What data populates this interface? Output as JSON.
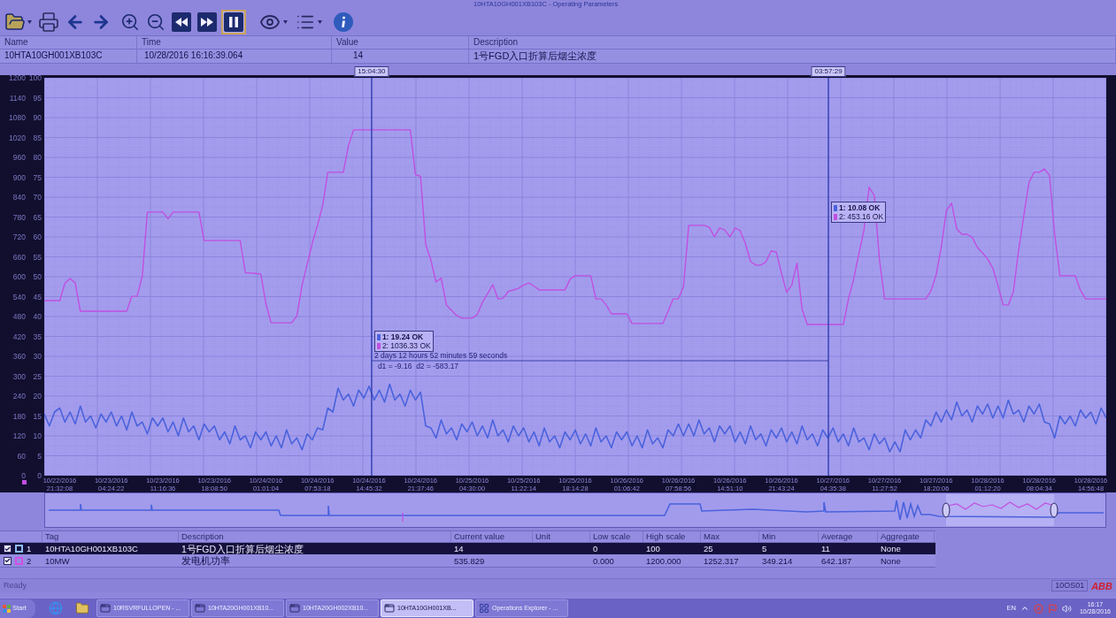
{
  "window": {
    "title": "10HTA10GH001XB103C - Operating Parameters"
  },
  "toolbar": {
    "pause_active": true
  },
  "header_table": {
    "columns": [
      "Name",
      "Time",
      "Value",
      "Description"
    ],
    "row": [
      "10HTA10GH001XB103C",
      "10/28/2016 16:16:39.064",
      "14",
      "1号FGD入口折算后烟尘浓度"
    ]
  },
  "cursors": [
    {
      "label": "15:04:30",
      "readings": [
        "1: 19.24 OK",
        "2: 1036.33 OK"
      ]
    },
    {
      "label": "03:57:29",
      "readings": [
        "1: 10.08 OK",
        "2: 453.16 OK"
      ]
    }
  ],
  "cursor_span": {
    "duration": "2 days 12 hours 52 minutes 59 seconds",
    "difference": "d1 = -9.16  d2 = -583.17"
  },
  "chart_data": {
    "type": "line",
    "grid": true,
    "categories": [
      null,
      null,
      null,
      "10/22/2016 21:32:08",
      null,
      null,
      null,
      null,
      null,
      null,
      null,
      null,
      null,
      "10/23/2016 04:24:22",
      null,
      null,
      null,
      null,
      null,
      null,
      null,
      null,
      null,
      "10/23/2016 11:16:36",
      null,
      null,
      null,
      null,
      null,
      null,
      null,
      null,
      null,
      "10/23/2016 18:08:50",
      null,
      null,
      null,
      null,
      null,
      null,
      null,
      null,
      null,
      "10/24/2016 01:01:04",
      null,
      null,
      null,
      null,
      null,
      null,
      null,
      null,
      null,
      "10/24/2016 07:53:18",
      null,
      null,
      null,
      null,
      null,
      null,
      null,
      null,
      null,
      "10/24/2016 14:45:32",
      null,
      null,
      null,
      null,
      null,
      null,
      null,
      null,
      null,
      "10/24/2016 21:37:46",
      null,
      null,
      null,
      null,
      null,
      null,
      null,
      null,
      null,
      "10/25/2016 04:30:00",
      null,
      null,
      null,
      null,
      null,
      null,
      null,
      null,
      null,
      "10/25/2016 11:22:14",
      null,
      null,
      null,
      null,
      null,
      null,
      null,
      null,
      null,
      "10/25/2016 18:14:28",
      null,
      null,
      null,
      null,
      null,
      null,
      null,
      null,
      null,
      "10/26/2016 01:06:42",
      null,
      null,
      null,
      null,
      null,
      null,
      null,
      null,
      null,
      "10/26/2016 07:58:56",
      null,
      null,
      null,
      null,
      null,
      null,
      null,
      null,
      null,
      "10/26/2016 14:51:10",
      null,
      null,
      null,
      null,
      null,
      null,
      null,
      null,
      null,
      "10/26/2016 21:43:24",
      null,
      null,
      null,
      null,
      null,
      null,
      null,
      null,
      null,
      "10/27/2016 04:35:38",
      null,
      null,
      null,
      null,
      null,
      null,
      null,
      null,
      null,
      "10/27/2016 11:27:52",
      null,
      null,
      null,
      null,
      null,
      null,
      null,
      null,
      null,
      "10/27/2016 18:20:06",
      null,
      null,
      null,
      null,
      null,
      null,
      null,
      null,
      null,
      "10/28/2016 01:12:20",
      null,
      null,
      null,
      null,
      null,
      null,
      null,
      null,
      null,
      "10/28/2016 08:04:34",
      null,
      null,
      null,
      null,
      null,
      null,
      null,
      null,
      null,
      "10/28/2016 14:56:48",
      null,
      null,
      null
    ],
    "ylim": [
      0,
      1200
    ],
    "yticks": [
      0,
      60,
      120,
      180,
      240,
      300,
      360,
      420,
      480,
      540,
      600,
      660,
      720,
      780,
      840,
      900,
      960,
      1020,
      1080,
      1140,
      1200
    ],
    "y2lim": [
      0,
      100
    ],
    "y2ticks": [
      0,
      5,
      10,
      15,
      20,
      25,
      30,
      35,
      40,
      45,
      50,
      55,
      60,
      65,
      70,
      75,
      80,
      85,
      90,
      95,
      100
    ],
    "series": [
      {
        "color": "#4a62dc",
        "axis": "y2",
        "values": [
          15.5,
          12.5,
          16,
          17,
          13.5,
          16,
          13,
          17.5,
          13.5,
          15,
          12,
          15.5,
          13.5,
          16,
          12.5,
          15,
          11.5,
          16,
          12.5,
          13.5,
          10.5,
          14.5,
          12.5,
          14.5,
          11,
          13.5,
          10,
          14.5,
          11,
          12.5,
          9,
          13,
          11,
          12.5,
          9,
          11,
          8,
          12.5,
          9,
          10,
          7,
          11,
          9,
          11,
          7.5,
          10,
          7,
          11.5,
          8,
          9.5,
          6.5,
          10.5,
          9,
          12,
          11.5,
          17,
          16,
          22,
          19,
          20.5,
          17.5,
          21.5,
          19.5,
          22.5,
          19,
          21.5,
          18.5,
          23,
          19,
          20.5,
          17.5,
          21.5,
          19,
          21,
          12.5,
          12,
          9.5,
          14,
          10.5,
          12,
          9,
          13,
          11,
          13.5,
          10,
          12.5,
          9.5,
          14,
          10,
          11.5,
          8.5,
          12.5,
          10,
          12,
          8.5,
          11,
          7.5,
          12,
          8.5,
          10,
          7,
          11,
          9,
          11.5,
          8,
          10.5,
          7.5,
          12,
          8.5,
          10,
          7,
          11,
          9,
          11,
          7.5,
          10,
          7,
          11.5,
          8,
          9.5,
          7,
          11.5,
          10,
          13,
          10,
          13,
          10,
          14,
          10.5,
          12,
          8.5,
          12.5,
          10.5,
          12.5,
          8.5,
          11,
          8,
          12.5,
          9,
          10.5,
          7.5,
          11.5,
          9.5,
          12,
          8.5,
          11,
          8,
          12.5,
          9,
          10.5,
          7.5,
          11.5,
          9.5,
          12,
          8.5,
          10.5,
          7.5,
          12,
          8.5,
          9.5,
          6.5,
          10.5,
          8,
          9.5,
          6,
          8.5,
          6,
          11.5,
          9,
          11.5,
          9.5,
          14,
          12.5,
          16,
          13.5,
          16.5,
          14,
          18.5,
          15,
          16.5,
          13.5,
          17.5,
          15.5,
          18,
          14.5,
          17.5,
          14.5,
          19,
          15.5,
          16.5,
          13.5,
          17.5,
          15.5,
          18,
          13.5,
          13,
          9.5,
          15,
          13,
          15,
          12.5,
          16.5,
          14.5,
          16,
          13,
          17,
          14.5
        ]
      },
      {
        "color": "#c04fe0",
        "axis": "y",
        "values": [
          528,
          528,
          528,
          528,
          580,
          595,
          581,
          496,
          496,
          496,
          496,
          496,
          496,
          496,
          496,
          496,
          496,
          541,
          541,
          600,
          795,
          795,
          795,
          795,
          775,
          795,
          795,
          795,
          795,
          795,
          795,
          709,
          709,
          709,
          709,
          709,
          709,
          709,
          709,
          612,
          611,
          610,
          608,
          518,
          461,
          461,
          461,
          461,
          461,
          482,
          574,
          638,
          702,
          755,
          815,
          915,
          915,
          915,
          915,
          995,
          1043,
          1043,
          1043,
          1043,
          1043,
          1043,
          1043,
          1043,
          1043,
          1043,
          1043,
          1043,
          908,
          903,
          696,
          650,
          584,
          596,
          515,
          499,
          483,
          475,
          475,
          475,
          486,
          523,
          549,
          576,
          533,
          535,
          556,
          560,
          565,
          575,
          581,
          572,
          560,
          560,
          560,
          560,
          560,
          560,
          593,
          603,
          603,
          603,
          603,
          533,
          533,
          515,
          488,
          488,
          488,
          488,
          459,
          459,
          459,
          459,
          459,
          459,
          459,
          496,
          533,
          533,
          570,
          755,
          755,
          755,
          755,
          749,
          720,
          747,
          741,
          720,
          747,
          739,
          700,
          646,
          635,
          635,
          645,
          678,
          674,
          611,
          553,
          575,
          641,
          502,
          456,
          456,
          456,
          456,
          456,
          456,
          456,
          456,
          533,
          593,
          669,
          740,
          870,
          845,
          652,
          533,
          533,
          533,
          533,
          533,
          533,
          533,
          533,
          533,
          557,
          606,
          690,
          800,
          822,
          744,
          728,
          728,
          719,
          688,
          672,
          653,
          626,
          573,
          515,
          515,
          555,
          681,
          783,
          884,
          915,
          915,
          925,
          906,
          728,
          603,
          603,
          603,
          603,
          559,
          533,
          533,
          533,
          533,
          533
        ]
      }
    ]
  },
  "tags": {
    "columns": [
      "Tag",
      "Description",
      "Current value",
      "Unit",
      "Low scale",
      "High scale",
      "Max",
      "Min",
      "Average",
      "Aggregate"
    ],
    "rows": [
      {
        "index": "1",
        "checked": true,
        "selected": true,
        "color": "#8fbaf8",
        "tag": "10HTA10GH001XB103C",
        "description": "1号FGD入口折算后烟尘浓度",
        "current_value": "14",
        "low_scale": "0",
        "high_scale": "100",
        "max": "25",
        "min": "5",
        "average": "11",
        "aggregate": "None"
      },
      {
        "index": "2",
        "checked": true,
        "selected": false,
        "color": "#d24fe6",
        "tag": "10MW",
        "description": "发电机功率",
        "current_value": "535.829",
        "low_scale": "0.000",
        "high_scale": "1200.000",
        "max": "1252.317",
        "min": "349.214",
        "average": "642.187",
        "aggregate": "None"
      }
    ]
  },
  "status_bar": {
    "text": "Ready",
    "node": "10OS01",
    "logo": "ABB"
  },
  "taskbar": {
    "start": "Start",
    "tasks": [
      {
        "label": "10RSVRFULLOPEN - ...",
        "selected": false
      },
      {
        "label": "10HTA20GH001XB10...",
        "selected": false
      },
      {
        "label": "10HTA20GH002XB10...",
        "selected": false
      },
      {
        "label": "10HTA10GH001XB...",
        "selected": true
      },
      {
        "label": "Operations Explorer - ...",
        "selected": false
      }
    ],
    "language": "EN",
    "time": "16:17",
    "date": "10/28/2016"
  }
}
